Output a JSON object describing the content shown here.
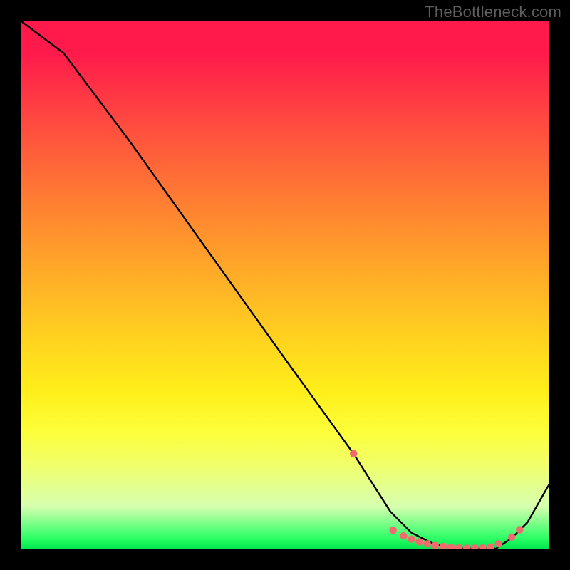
{
  "watermark": "TheBottleneck.com",
  "chart_data": {
    "type": "line",
    "title": "",
    "xlabel": "",
    "ylabel": "",
    "xlim": [
      0,
      100
    ],
    "ylim": [
      0,
      100
    ],
    "series": [
      {
        "name": "curve",
        "x": [
          0,
          8,
          20,
          35,
          50,
          63,
          70,
          74,
          78,
          82,
          86,
          90,
          93,
          96,
          100
        ],
        "y": [
          100,
          94,
          78,
          57,
          36,
          18,
          7,
          3,
          1,
          0,
          0,
          0,
          2,
          5,
          12
        ]
      }
    ],
    "markers": {
      "name": "dots",
      "color": "#f06a6e",
      "x": [
        63,
        70.5,
        72.5,
        74,
        75.5,
        77,
        78.5,
        80,
        81.5,
        83,
        84.5,
        86,
        87.5,
        89,
        90.5,
        93,
        94.5
      ],
      "y": [
        18,
        3.5,
        2.4,
        1.8,
        1.3,
        0.9,
        0.6,
        0.4,
        0.25,
        0.15,
        0.1,
        0.1,
        0.15,
        0.3,
        0.9,
        2.2,
        3.6
      ]
    },
    "gradient_stops": [
      {
        "pct": 0,
        "color": "#ff1a4b"
      },
      {
        "pct": 6,
        "color": "#ff1a4b"
      },
      {
        "pct": 20,
        "color": "#ff4d3f"
      },
      {
        "pct": 33,
        "color": "#ff7a33"
      },
      {
        "pct": 46,
        "color": "#ffa529"
      },
      {
        "pct": 60,
        "color": "#ffd21f"
      },
      {
        "pct": 70,
        "color": "#ffee1a"
      },
      {
        "pct": 78,
        "color": "#fcff3a"
      },
      {
        "pct": 84,
        "color": "#f1ff6a"
      },
      {
        "pct": 92,
        "color": "#d6ffb0"
      },
      {
        "pct": 98,
        "color": "#2dff66"
      },
      {
        "pct": 100,
        "color": "#00e84f"
      }
    ]
  }
}
